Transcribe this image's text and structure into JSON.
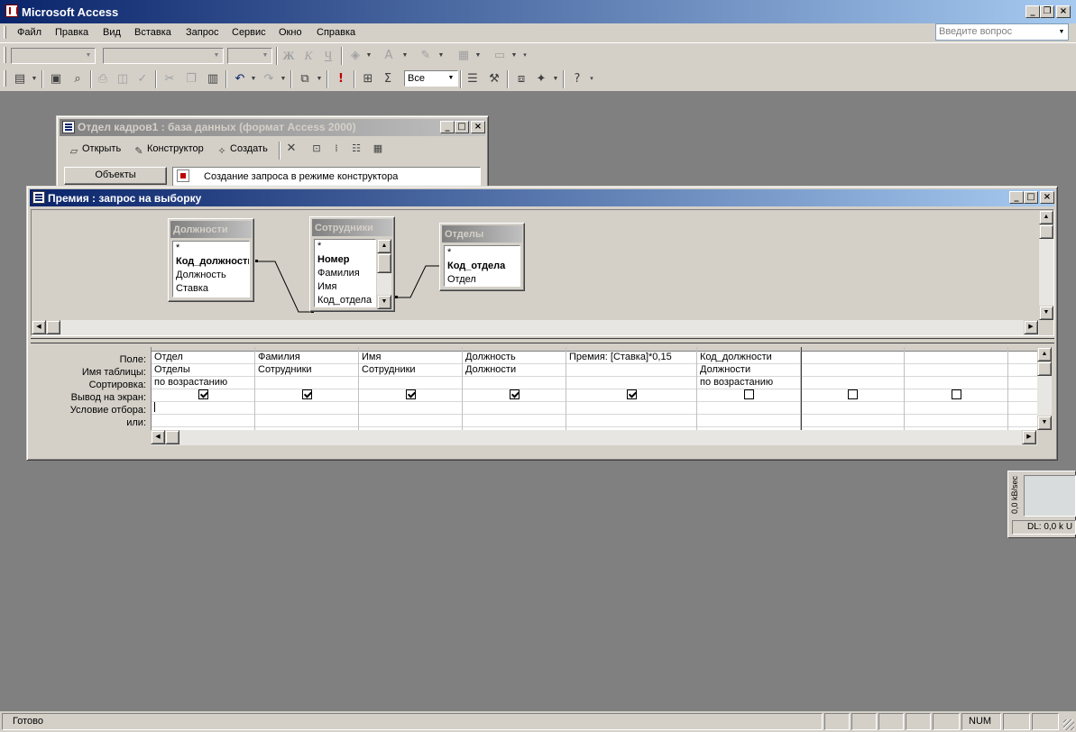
{
  "app": {
    "title": "Microsoft Access"
  },
  "menu": {
    "items": [
      "Файл",
      "Правка",
      "Вид",
      "Вставка",
      "Запрос",
      "Сервис",
      "Окно",
      "Справка"
    ]
  },
  "help_box": {
    "placeholder": "Введите вопрос"
  },
  "toolbar": {
    "bold": "Ж",
    "italic": "К",
    "underline": "Ч",
    "top_values": "Все"
  },
  "db_window": {
    "title": "Отдел кадров1 : база данных (формат Access 2000)",
    "open": "Открыть",
    "design": "Конструктор",
    "create": "Создать",
    "objects_label": "Объекты",
    "first_item": "Создание запроса в режиме конструктора"
  },
  "query_window": {
    "title": "Премия : запрос на выборку",
    "tables": [
      {
        "name": "Должности",
        "fields": [
          "*",
          "Код_должности",
          "Должность",
          "Ставка"
        ],
        "bold": [
          1
        ]
      },
      {
        "name": "Сотрудники",
        "fields": [
          "*",
          "Номер",
          "Фамилия",
          "Имя",
          "Код_отдела"
        ],
        "bold": [
          1
        ]
      },
      {
        "name": "Отделы",
        "fields": [
          "*",
          "Код_отдела",
          "Отдел"
        ],
        "bold": [
          1
        ]
      }
    ],
    "row_labels": [
      "Поле:",
      "Имя таблицы:",
      "Сортировка:",
      "Вывод на экран:",
      "Условие отбора:",
      "или:"
    ],
    "columns": [
      {
        "field": "Отдел",
        "table": "Отделы",
        "sort": "по возрастанию",
        "show": true
      },
      {
        "field": "Фамилия",
        "table": "Сотрудники",
        "sort": "",
        "show": true
      },
      {
        "field": "Имя",
        "table": "Сотрудники",
        "sort": "",
        "show": true
      },
      {
        "field": "Должность",
        "table": "Должности",
        "sort": "",
        "show": true
      },
      {
        "field": "Премия: [Ставка]*0,15",
        "table": "",
        "sort": "",
        "show": true
      },
      {
        "field": "Код_должности",
        "table": "Должности",
        "sort": "по возрастанию",
        "show": false
      },
      {
        "field": "",
        "table": "",
        "sort": "",
        "show": false
      },
      {
        "field": "",
        "table": "",
        "sort": "",
        "show": false
      },
      {
        "field": "",
        "table": "",
        "sort": "",
        "show": null
      }
    ]
  },
  "net_widget": {
    "axis": "0,0 kB/sec",
    "dl": "DL: 0,0 k",
    "extra": "U"
  },
  "status": {
    "text": "Готово",
    "num": "NUM"
  }
}
